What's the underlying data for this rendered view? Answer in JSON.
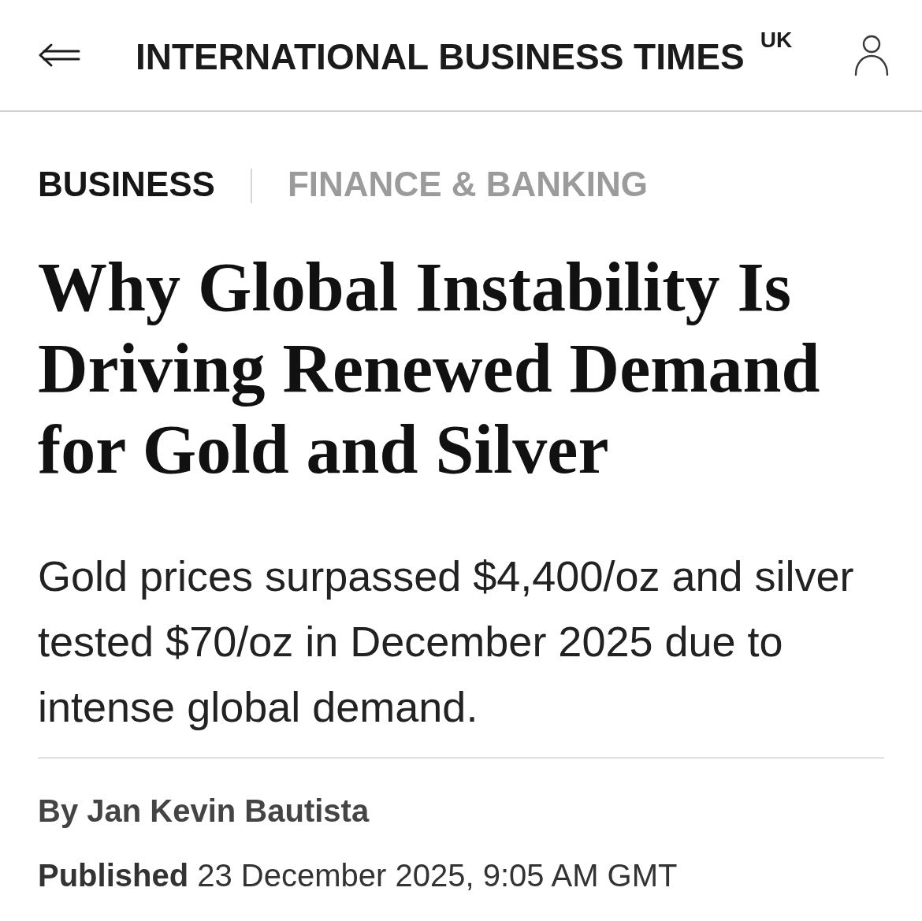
{
  "header": {
    "title": "INTERNATIONAL BUSINESS TIMES",
    "edition": "UK"
  },
  "categories": [
    {
      "label": "BUSINESS",
      "kind": "primary"
    },
    {
      "label": "FINANCE & BANKING",
      "kind": "secondary"
    }
  ],
  "article": {
    "headline": "Why Global Instability Is Driving Renewed Demand for Gold and Silver",
    "standfirst": "Gold prices surpassed $4,400/oz and silver tested $70/oz in December 2025 due to intense global demand.",
    "byline": "By **Jan Kevin Bautista**",
    "published": "**Published** 23 December 2025, 9:05 AM GMT"
  }
}
